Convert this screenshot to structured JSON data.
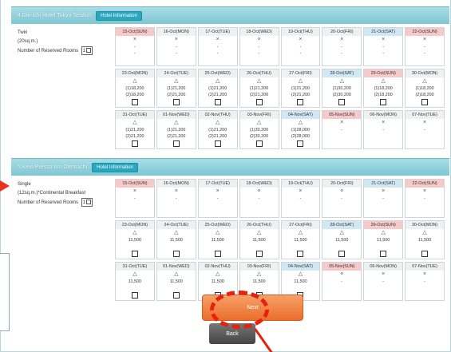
{
  "hotels": [
    {
      "name": "4.Dai-ichi Hotel Tokyo Seafort",
      "info_label": "Hotel Information",
      "room_type": "Twin",
      "room_size": "(20sq.m.)",
      "rooms_label": "Number of Reserved Rooms",
      "rooms_value": "1",
      "weeks": [
        [
          {
            "date": "15-Oct(SUN)",
            "kind": "sun",
            "sym": "×",
            "p1": "-",
            "p2": "-",
            "cb": false
          },
          {
            "date": "16-Oct(MON)",
            "kind": "",
            "sym": "×",
            "p1": "-",
            "p2": "-",
            "cb": false
          },
          {
            "date": "17-Oct(TUE)",
            "kind": "",
            "sym": "×",
            "p1": "-",
            "p2": "-",
            "cb": false
          },
          {
            "date": "18-Oct(WED)",
            "kind": "",
            "sym": "×",
            "p1": "-",
            "p2": "-",
            "cb": false
          },
          {
            "date": "19-Oct(THU)",
            "kind": "",
            "sym": "×",
            "p1": "-",
            "p2": "-",
            "cb": false
          },
          {
            "date": "20-Oct(FRI)",
            "kind": "",
            "sym": "×",
            "p1": "-",
            "p2": "-",
            "cb": false
          },
          {
            "date": "21-Oct(SAT)",
            "kind": "sat",
            "sym": "×",
            "p1": "-",
            "p2": "-",
            "cb": false
          },
          {
            "date": "22-Oct(SUN)",
            "kind": "sun",
            "sym": "×",
            "p1": "-",
            "p2": "-",
            "cb": false
          }
        ],
        [
          {
            "date": "23-Oct(MON)",
            "kind": "",
            "sym": "△",
            "p1": "(1)18,200",
            "p2": "(2)18,200",
            "cb": true
          },
          {
            "date": "24-Oct(TUE)",
            "kind": "",
            "sym": "△",
            "p1": "(1)21,200",
            "p2": "(2)21,200",
            "cb": true
          },
          {
            "date": "25-Oct(WED)",
            "kind": "",
            "sym": "△",
            "p1": "(1)21,200",
            "p2": "(2)21,200",
            "cb": true
          },
          {
            "date": "26-Oct(THU)",
            "kind": "",
            "sym": "△",
            "p1": "(1)21,200",
            "p2": "(2)21,200",
            "cb": true
          },
          {
            "date": "27-Oct(FRI)",
            "kind": "",
            "sym": "△",
            "p1": "(1)21,200",
            "p2": "(2)21,200",
            "cb": true
          },
          {
            "date": "28-Oct(SAT)",
            "kind": "sat",
            "sym": "△",
            "p1": "(1)30,200",
            "p2": "(2)30,200",
            "cb": true
          },
          {
            "date": "29-Oct(SUN)",
            "kind": "sun",
            "sym": "△",
            "p1": "(1)18,200",
            "p2": "(2)18,200",
            "cb": true
          },
          {
            "date": "30-Oct(MON)",
            "kind": "",
            "sym": "△",
            "p1": "(1)18,200",
            "p2": "(2)18,200",
            "cb": true
          }
        ],
        [
          {
            "date": "31-Oct(TUE)",
            "kind": "",
            "sym": "△",
            "p1": "(1)21,200",
            "p2": "(2)21,200",
            "cb": true
          },
          {
            "date": "01-Nov(WED)",
            "kind": "",
            "sym": "△",
            "p1": "(1)21,200",
            "p2": "(2)21,200",
            "cb": true
          },
          {
            "date": "02-Nov(THU)",
            "kind": "",
            "sym": "△",
            "p1": "(1)21,200",
            "p2": "(2)21,200",
            "cb": true
          },
          {
            "date": "03-Nov(FRI)",
            "kind": "",
            "sym": "△",
            "p1": "(1)30,200",
            "p2": "(2)30,200",
            "cb": true
          },
          {
            "date": "04-Nov(SAT)",
            "kind": "sat",
            "sym": "△",
            "p1": "(1)28,000",
            "p2": "(2)28,000",
            "cb": true
          },
          {
            "date": "05-Nov(SUN)",
            "kind": "sun",
            "sym": "×",
            "p1": "-",
            "p2": "",
            "cb": false
          },
          {
            "date": "06-Nov(MON)",
            "kind": "",
            "sym": "×",
            "p1": "-",
            "p2": "",
            "cb": false
          },
          {
            "date": "07-Nov(TUE)",
            "kind": "",
            "sym": "×",
            "p1": "-",
            "p2": "",
            "cb": false
          }
        ]
      ]
    },
    {
      "name": "5.Keio Presso Inn Otemachi",
      "info_label": "Hotel Information",
      "room_type": "Single",
      "room_size": "(12sq.m.)*Continental Breakfast",
      "rooms_label": "Number of Reserved Rooms",
      "rooms_value": "1",
      "weeks": [
        [
          {
            "date": "15-Oct(SUN)",
            "kind": "sun",
            "sym": "×",
            "p1": "-",
            "p2": "",
            "cb": false
          },
          {
            "date": "16-Oct(MON)",
            "kind": "",
            "sym": "×",
            "p1": "-",
            "p2": "",
            "cb": false
          },
          {
            "date": "17-Oct(TUE)",
            "kind": "",
            "sym": "×",
            "p1": "-",
            "p2": "",
            "cb": false
          },
          {
            "date": "18-Oct(WED)",
            "kind": "",
            "sym": "×",
            "p1": "-",
            "p2": "",
            "cb": false
          },
          {
            "date": "19-Oct(THU)",
            "kind": "",
            "sym": "×",
            "p1": "-",
            "p2": "",
            "cb": false
          },
          {
            "date": "20-Oct(FRI)",
            "kind": "",
            "sym": "×",
            "p1": "-",
            "p2": "",
            "cb": false
          },
          {
            "date": "21-Oct(SAT)",
            "kind": "sat",
            "sym": "×",
            "p1": "-",
            "p2": "",
            "cb": false
          },
          {
            "date": "22-Oct(SUN)",
            "kind": "sun",
            "sym": "×",
            "p1": "-",
            "p2": "",
            "cb": false
          }
        ],
        [
          {
            "date": "23-Oct(MON)",
            "kind": "",
            "sym": "△",
            "p1": "11,500",
            "p2": "",
            "cb": true
          },
          {
            "date": "24-Oct(TUE)",
            "kind": "",
            "sym": "△",
            "p1": "11,500",
            "p2": "",
            "cb": true
          },
          {
            "date": "25-Oct(WED)",
            "kind": "",
            "sym": "△",
            "p1": "11,500",
            "p2": "",
            "cb": true
          },
          {
            "date": "26-Oct(THU)",
            "kind": "",
            "sym": "△",
            "p1": "11,500",
            "p2": "",
            "cb": true
          },
          {
            "date": "27-Oct(FRI)",
            "kind": "",
            "sym": "△",
            "p1": "11,500",
            "p2": "",
            "cb": true
          },
          {
            "date": "28-Oct(SAT)",
            "kind": "sat",
            "sym": "△",
            "p1": "11,500",
            "p2": "",
            "cb": true
          },
          {
            "date": "29-Oct(SUN)",
            "kind": "sun",
            "sym": "△",
            "p1": "11,500",
            "p2": "",
            "cb": true
          },
          {
            "date": "30-Oct(MON)",
            "kind": "",
            "sym": "△",
            "p1": "11,500",
            "p2": "",
            "cb": true
          }
        ],
        [
          {
            "date": "31-Oct(TUE)",
            "kind": "",
            "sym": "△",
            "p1": "11,500",
            "p2": "",
            "cb": true
          },
          {
            "date": "01-Nov(WED)",
            "kind": "",
            "sym": "△",
            "p1": "11,500",
            "p2": "",
            "cb": true
          },
          {
            "date": "02-Nov(THU)",
            "kind": "",
            "sym": "△",
            "p1": "11,500",
            "p2": "",
            "cb": true
          },
          {
            "date": "03-Nov(FRI)",
            "kind": "",
            "sym": "△",
            "p1": "11,500",
            "p2": "",
            "cb": true
          },
          {
            "date": "04-Nov(SAT)",
            "kind": "sat",
            "sym": "△",
            "p1": "11,500",
            "p2": "",
            "cb": true
          },
          {
            "date": "05-Nov(SUN)",
            "kind": "sun",
            "sym": "×",
            "p1": "-",
            "p2": "",
            "cb": false
          },
          {
            "date": "06-Nov(MON)",
            "kind": "",
            "sym": "×",
            "p1": "-",
            "p2": "",
            "cb": false
          },
          {
            "date": "07-Nov(TUE)",
            "kind": "",
            "sym": "×",
            "p1": "-",
            "p2": "",
            "cb": false
          }
        ]
      ]
    }
  ],
  "buttons": {
    "next_label": "Next",
    "back_label": "Back"
  },
  "colors": {
    "header": "#7fc6d3",
    "next": "#ea6e2b",
    "highlight": "#e8200e"
  }
}
